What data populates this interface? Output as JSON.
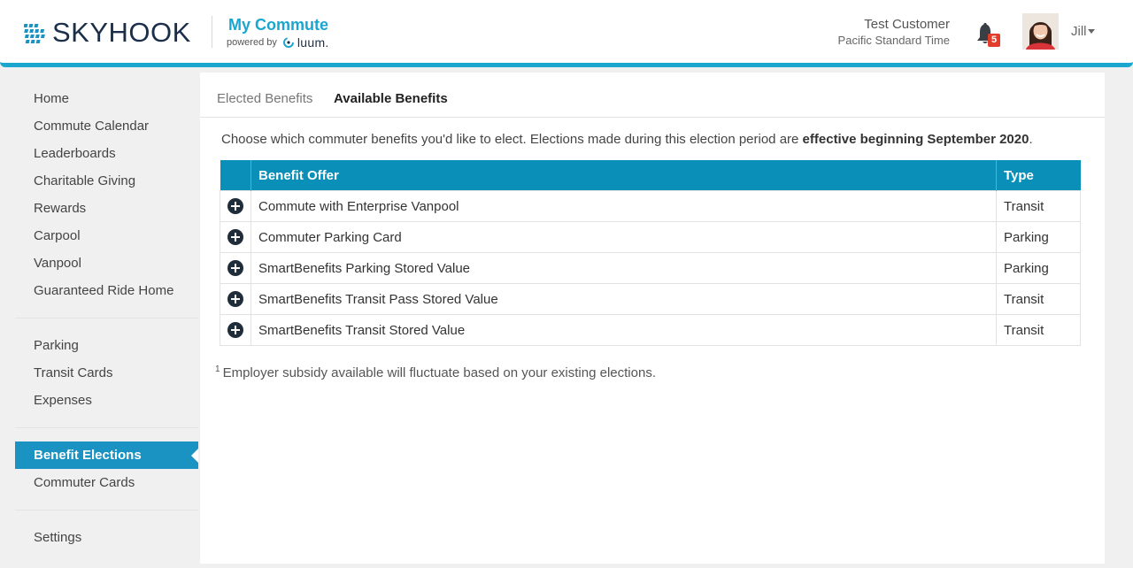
{
  "header": {
    "brand": "SKYHOOK",
    "app_title": "My Commute",
    "powered_by": "powered by",
    "powered_brand": "luum.",
    "user_full_name": "Test Customer",
    "timezone": "Pacific Standard Time",
    "notification_count": "5",
    "user_short_name": "Jill"
  },
  "sidebar": {
    "group1": [
      "Home",
      "Commute Calendar",
      "Leaderboards",
      "Charitable Giving",
      "Rewards",
      "Carpool",
      "Vanpool",
      "Guaranteed Ride Home"
    ],
    "group2": [
      "Parking",
      "Transit Cards",
      "Expenses"
    ],
    "group3": [
      "Benefit Elections",
      "Commuter Cards"
    ],
    "group4": [
      "Settings"
    ],
    "active": "Benefit Elections"
  },
  "tabs": [
    {
      "label": "Elected Benefits",
      "active": false
    },
    {
      "label": "Available Benefits",
      "active": true
    }
  ],
  "intro": {
    "text": "Choose which commuter benefits you'd like to elect. Elections made during this election period are ",
    "bold": "effective beginning September 2020",
    "end": "."
  },
  "table": {
    "headers": [
      "Benefit Offer",
      "Type"
    ],
    "rows": [
      {
        "offer": "Commute with Enterprise Vanpool",
        "type": "Transit"
      },
      {
        "offer": "Commuter Parking Card",
        "type": "Parking"
      },
      {
        "offer": "SmartBenefits Parking Stored Value",
        "type": "Parking"
      },
      {
        "offer": "SmartBenefits Transit Pass Stored Value",
        "type": "Transit"
      },
      {
        "offer": "SmartBenefits Transit Stored Value",
        "type": "Transit"
      }
    ]
  },
  "footnote": {
    "marker": "1",
    "text": "Employer subsidy available will fluctuate based on your existing elections."
  },
  "colors": {
    "accent": "#1aa6cf",
    "table_header": "#0a8fb8",
    "active_nav": "#1a93c2",
    "badge": "#e23c2a"
  }
}
